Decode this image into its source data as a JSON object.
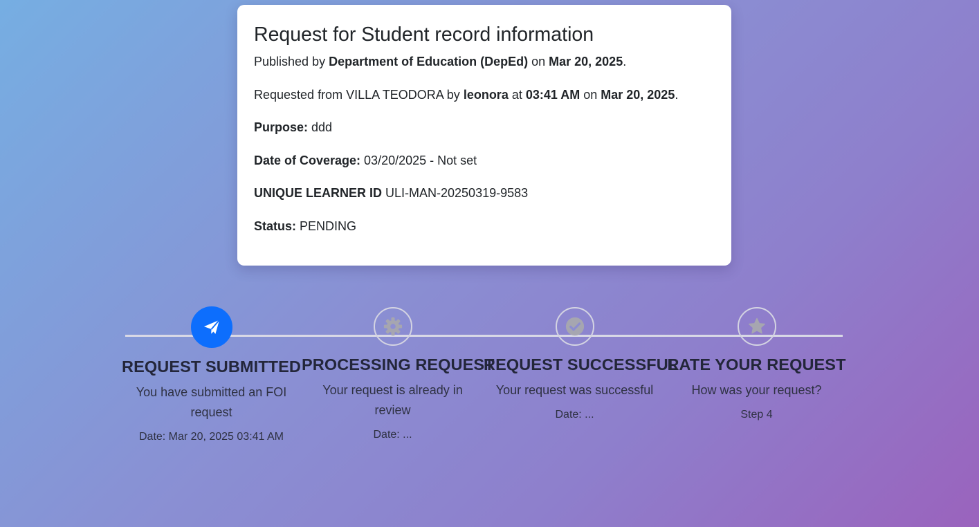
{
  "request": {
    "title": "Request for Student record information",
    "published_prefix": "Published by ",
    "publisher": "Department of Education (DepEd)",
    "published_on": " on ",
    "published_date": "Mar 20, 2025",
    "published_end": ".",
    "requested_prefix": "Requested from VILLA TEODORA by ",
    "requester": "leonora",
    "requested_at": " at ",
    "requested_time": "03:41 AM",
    "requested_on": " on ",
    "requested_date": "Mar 20, 2025",
    "requested_end": ".",
    "purpose_label": "Purpose:",
    "purpose_value": " ddd",
    "coverage_label": "Date of Coverage:",
    "coverage_value": " 03/20/2025 - Not set",
    "learner_id_label": "UNIQUE LEARNER ID",
    "learner_id_value": " ULI-MAN-20250319-9583",
    "status_label": "Status:",
    "status_value": " PENDING"
  },
  "steps": [
    {
      "icon": "paper-plane-icon",
      "title": "REQUEST SUBMITTED",
      "description": "You have submitted an FOI request",
      "meta": "Date: Mar 20, 2025 03:41 AM",
      "state": "active"
    },
    {
      "icon": "gear-icon",
      "title": "PROCESSING REQUEST",
      "description": "Your request is already in review",
      "meta": "Date: ...",
      "state": "inactive"
    },
    {
      "icon": "check-circle-icon",
      "title": "REQUEST SUCCESSFUL",
      "description": "Your request was successful",
      "meta": "Date: ...",
      "state": "inactive"
    },
    {
      "icon": "star-icon",
      "title": "RATE YOUR REQUEST",
      "description": "How was your request?",
      "meta": "Step 4",
      "state": "inactive"
    }
  ],
  "colors": {
    "active": "#0d6efd",
    "inactive_icon": "#a6a6b0",
    "line": "#d9d9e6"
  }
}
